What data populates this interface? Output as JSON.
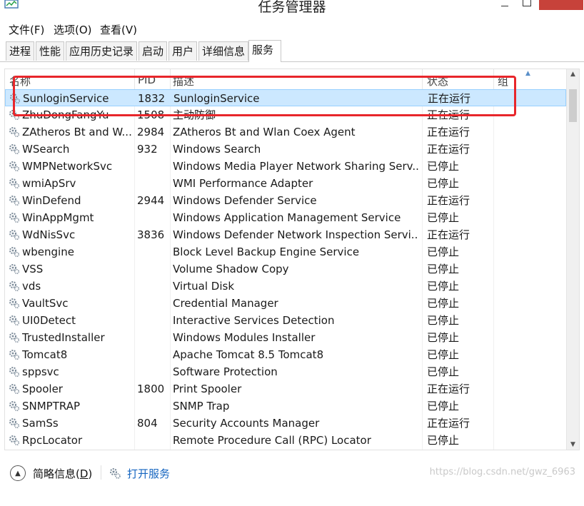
{
  "window": {
    "title": "任务管理器"
  },
  "menu": [
    {
      "label": "文件(F)"
    },
    {
      "label": "选项(O)"
    },
    {
      "label": "查看(V)"
    }
  ],
  "tabs": [
    {
      "label": "进程"
    },
    {
      "label": "性能"
    },
    {
      "label": "应用历史记录"
    },
    {
      "label": "启动"
    },
    {
      "label": "用户"
    },
    {
      "label": "详细信息"
    },
    {
      "label": "服务",
      "active": true
    }
  ],
  "columns": {
    "name": "名称",
    "pid": "PID",
    "desc": "描述",
    "status": "状态",
    "group": "组"
  },
  "services": [
    {
      "name": "SunloginService",
      "pid": "1832",
      "desc": "SunloginService",
      "status": "正在运行",
      "selected": true
    },
    {
      "name": "ZhuDongFangYu",
      "pid": "1508",
      "desc": "主动防御",
      "status": "正在运行"
    },
    {
      "name": "ZAtheros Bt and W...",
      "pid": "2984",
      "desc": "ZAtheros Bt and Wlan Coex Agent",
      "status": "正在运行"
    },
    {
      "name": "WSearch",
      "pid": "932",
      "desc": "Windows Search",
      "status": "正在运行"
    },
    {
      "name": "WMPNetworkSvc",
      "pid": "",
      "desc": "Windows Media Player Network Sharing Serv...",
      "status": "已停止"
    },
    {
      "name": "wmiApSrv",
      "pid": "",
      "desc": "WMI Performance Adapter",
      "status": "已停止"
    },
    {
      "name": "WinDefend",
      "pid": "2944",
      "desc": "Windows Defender Service",
      "status": "正在运行"
    },
    {
      "name": "WinAppMgmt",
      "pid": "",
      "desc": "Windows Application Management Service",
      "status": "已停止"
    },
    {
      "name": "WdNisSvc",
      "pid": "3836",
      "desc": "Windows Defender Network Inspection Servi...",
      "status": "正在运行"
    },
    {
      "name": "wbengine",
      "pid": "",
      "desc": "Block Level Backup Engine Service",
      "status": "已停止"
    },
    {
      "name": "VSS",
      "pid": "",
      "desc": "Volume Shadow Copy",
      "status": "已停止"
    },
    {
      "name": "vds",
      "pid": "",
      "desc": "Virtual Disk",
      "status": "已停止"
    },
    {
      "name": "VaultSvc",
      "pid": "",
      "desc": "Credential Manager",
      "status": "已停止"
    },
    {
      "name": "UI0Detect",
      "pid": "",
      "desc": "Interactive Services Detection",
      "status": "已停止"
    },
    {
      "name": "TrustedInstaller",
      "pid": "",
      "desc": "Windows Modules Installer",
      "status": "已停止"
    },
    {
      "name": "Tomcat8",
      "pid": "",
      "desc": "Apache Tomcat 8.5 Tomcat8",
      "status": "已停止"
    },
    {
      "name": "sppsvc",
      "pid": "",
      "desc": "Software Protection",
      "status": "已停止"
    },
    {
      "name": "Spooler",
      "pid": "1800",
      "desc": "Print Spooler",
      "status": "正在运行"
    },
    {
      "name": "SNMPTRAP",
      "pid": "",
      "desc": "SNMP Trap",
      "status": "已停止"
    },
    {
      "name": "SamSs",
      "pid": "804",
      "desc": "Security Accounts Manager",
      "status": "正在运行"
    },
    {
      "name": "RpcLocator",
      "pid": "",
      "desc": "Remote Procedure Call (RPC) Locator",
      "status": "已停止"
    }
  ],
  "footer": {
    "fewer_details_text": "简略信息(",
    "fewer_details_key": "D",
    "fewer_details_close": ")",
    "open_services": "打开服务",
    "watermark": "https://blog.csdn.net/gwz_6963"
  },
  "colors": {
    "selection": "#cce8ff",
    "highlight_box": "#e8262b",
    "link": "#1565c0",
    "close_button": "#c7423a"
  },
  "icons": {
    "service": "gear-icon",
    "fewer_details": "chevron-up-icon",
    "open_services": "gear-icon"
  }
}
